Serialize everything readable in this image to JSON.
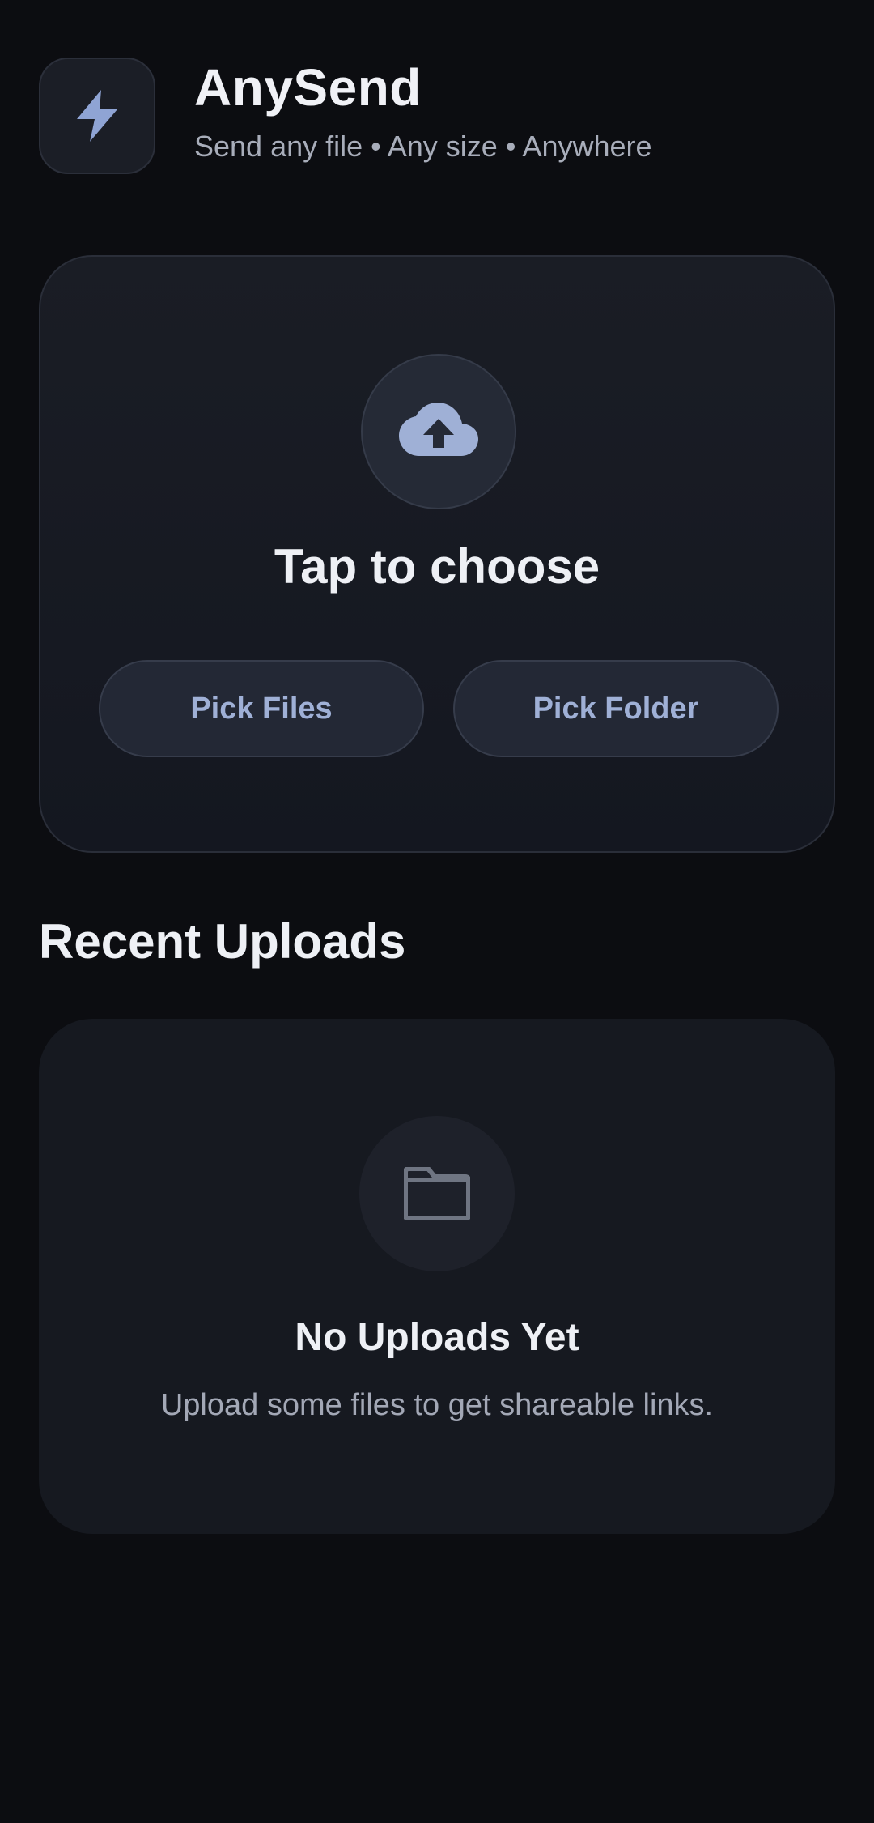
{
  "app": {
    "name": "AnySend",
    "tagline": "Send any file • Any size • Anywhere",
    "icon": "lightning-bolt-icon"
  },
  "upload": {
    "icon": "cloud-upload-icon",
    "title": "Tap to choose",
    "pick_files_label": "Pick Files",
    "pick_folder_label": "Pick Folder"
  },
  "recent": {
    "section_title": "Recent Uploads",
    "empty_icon": "folder-icon",
    "empty_title": "No Uploads Yet",
    "empty_description": "Upload some files to get shareable links."
  },
  "colors": {
    "background": "#0c0d11",
    "accent": "#9fb0d6",
    "card": "#161920"
  }
}
